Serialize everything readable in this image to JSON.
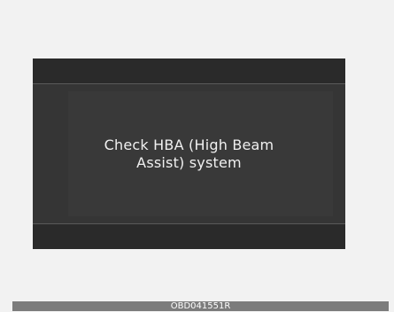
{
  "display": {
    "message_line1": "Check HBA (High Beam",
    "message_line2": "Assist) system"
  },
  "caption": {
    "code": "OBD041551R"
  },
  "colors": {
    "page_background": "#f2f2f2",
    "display_background": "#333333",
    "bar_background": "#2a2a2a",
    "divider": "#5a5a5a",
    "message_text": "#f0f0f0",
    "caption_bar": "#7c7c7c"
  }
}
